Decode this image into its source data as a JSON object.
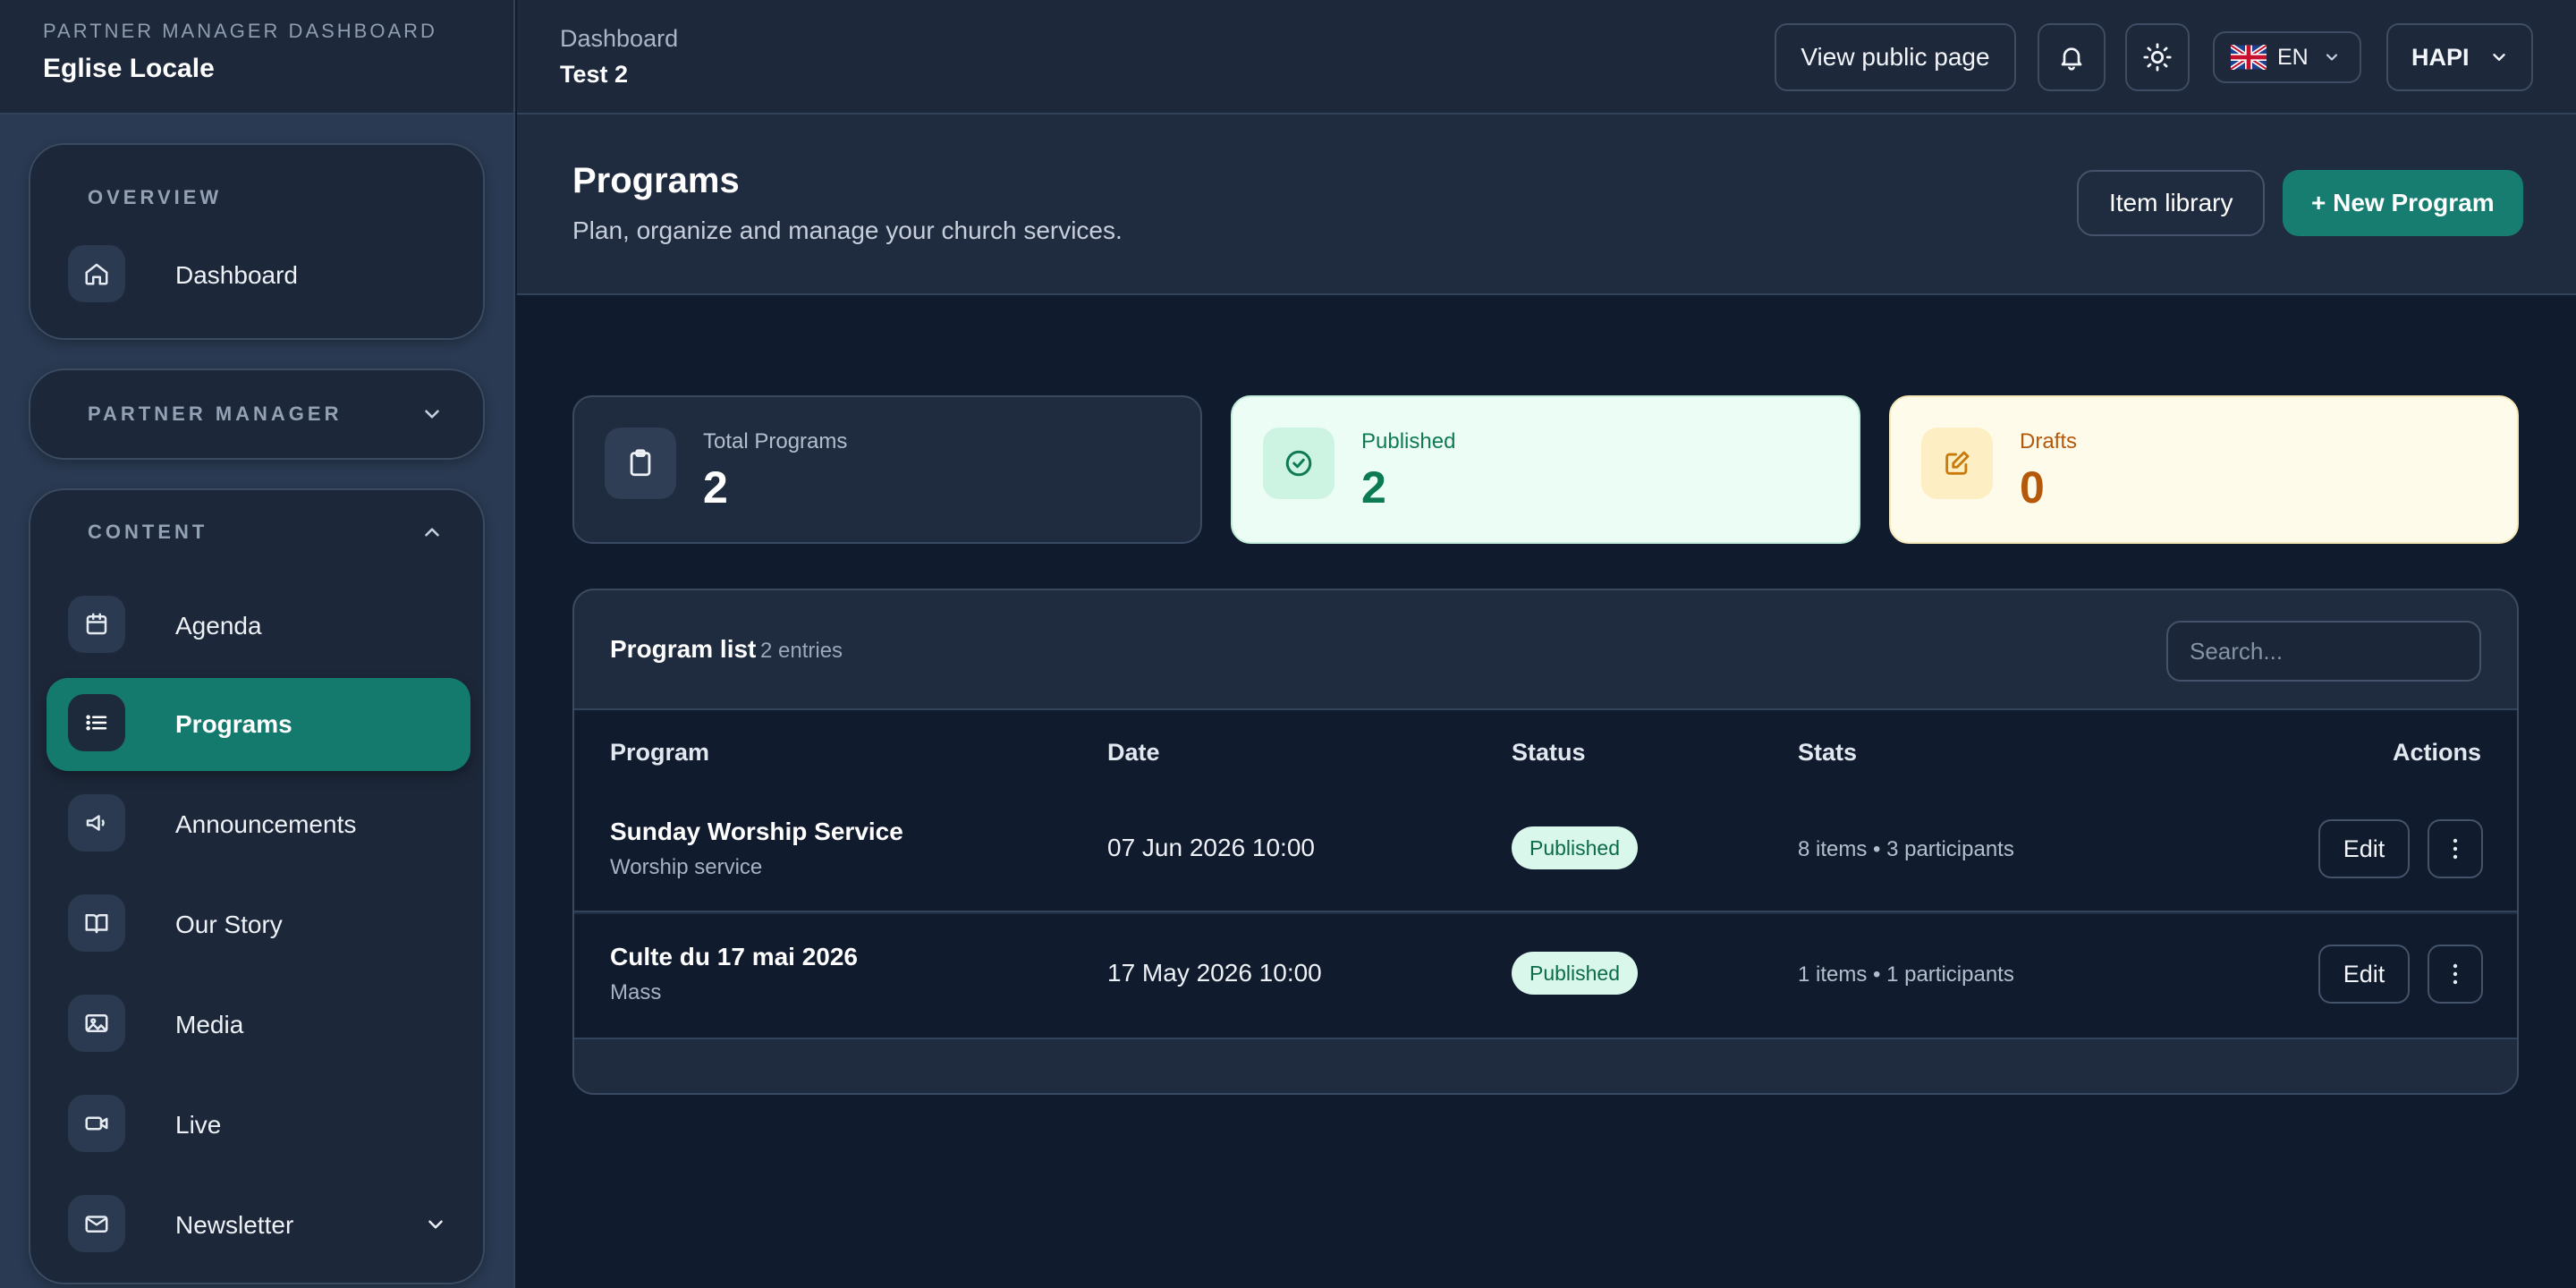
{
  "brand": {
    "eyebrow": "PARTNER MANAGER DASHBOARD",
    "name": "Eglise Locale"
  },
  "sidebar": {
    "overview": {
      "label": "OVERVIEW",
      "items": [
        {
          "label": "Dashboard",
          "icon": "home-icon"
        }
      ]
    },
    "partner_manager": {
      "label": "PARTNER MANAGER"
    },
    "content": {
      "label": "CONTENT",
      "items": [
        {
          "label": "Agenda",
          "icon": "calendar-icon"
        },
        {
          "label": "Programs",
          "icon": "list-icon",
          "active": true
        },
        {
          "label": "Announcements",
          "icon": "megaphone-icon"
        },
        {
          "label": "Our Story",
          "icon": "book-icon"
        },
        {
          "label": "Media",
          "icon": "image-icon"
        },
        {
          "label": "Live",
          "icon": "video-icon"
        },
        {
          "label": "Newsletter",
          "icon": "mail-icon"
        }
      ]
    }
  },
  "topbar": {
    "breadcrumb": "Dashboard",
    "context": "Test 2",
    "view_public": "View public page",
    "language": "EN",
    "user": "HAPI"
  },
  "page": {
    "title": "Programs",
    "subtitle": "Plan, organize and manage your church services.",
    "item_library": "Item library",
    "new_program": "+ New Program"
  },
  "stats": {
    "total": {
      "label": "Total Programs",
      "value": "2"
    },
    "published": {
      "label": "Published",
      "value": "2"
    },
    "drafts": {
      "label": "Drafts",
      "value": "0"
    }
  },
  "colors": {
    "accent": "#167d70",
    "published_bg": "#ebfdf5",
    "drafts_bg": "#fffbea"
  },
  "table": {
    "title": "Program list",
    "count": "2 entries",
    "search_placeholder": "Search...",
    "columns": {
      "program": "Program",
      "date": "Date",
      "status": "Status",
      "stats": "Stats",
      "actions": "Actions"
    },
    "rows": [
      {
        "name": "Sunday Worship Service",
        "type": "Worship service",
        "date": "07 Jun 2026 10:00",
        "status": "Published",
        "stats": "8 items • 3 participants",
        "edit": "Edit"
      },
      {
        "name": "Culte du 17 mai 2026",
        "type": "Mass",
        "date": "17 May 2026 10:00",
        "status": "Published",
        "stats": "1 items • 1 participants",
        "edit": "Edit"
      }
    ]
  }
}
